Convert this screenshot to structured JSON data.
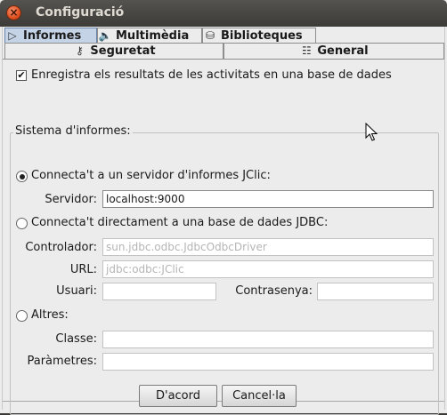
{
  "window": {
    "title": "Configuració",
    "close_glyph": "×"
  },
  "tabs": {
    "row1": [
      {
        "label": "Informes",
        "icon": "report-icon",
        "glyph": "▷",
        "selected": true
      },
      {
        "label": "Multimèdia",
        "icon": "speaker-icon",
        "glyph": "🔈",
        "selected": false
      },
      {
        "label": "Biblioteques",
        "icon": "database-icon",
        "glyph": "⛁",
        "selected": false
      }
    ],
    "row2": [
      {
        "label": "Seguretat",
        "icon": "key-icon",
        "glyph": "⚷",
        "selected": false
      },
      {
        "label": "General",
        "icon": "settings-icon",
        "glyph": "☷",
        "selected": false
      }
    ]
  },
  "panel": {
    "record_checkbox": {
      "label": "Enregistra els resultats de les activitats en una base de dades",
      "checked": true,
      "glyph": "✔"
    },
    "group_title": "Sistema d'informes:",
    "option_server": {
      "label": "Connecta't a un servidor d'informes JClic:",
      "selected": true
    },
    "server_label": "Servidor:",
    "server_value": "localhost:9000",
    "option_jdbc": {
      "label": "Connecta't directament a una base de dades JDBC:",
      "selected": false
    },
    "driver_label": "Controlador:",
    "driver_value": "sun.jdbc.odbc.JdbcOdbcDriver",
    "url_label": "URL:",
    "url_value": "jdbc:odbc:JClic",
    "user_label": "Usuari:",
    "user_value": "",
    "password_label": "Contrasenya:",
    "password_value": "",
    "option_others": {
      "label": "Altres:",
      "selected": false
    },
    "class_label": "Classe:",
    "class_value": "",
    "params_label": "Paràmetres:",
    "params_value": ""
  },
  "buttons": {
    "ok": "D'acord",
    "cancel": "Cancel·la"
  }
}
